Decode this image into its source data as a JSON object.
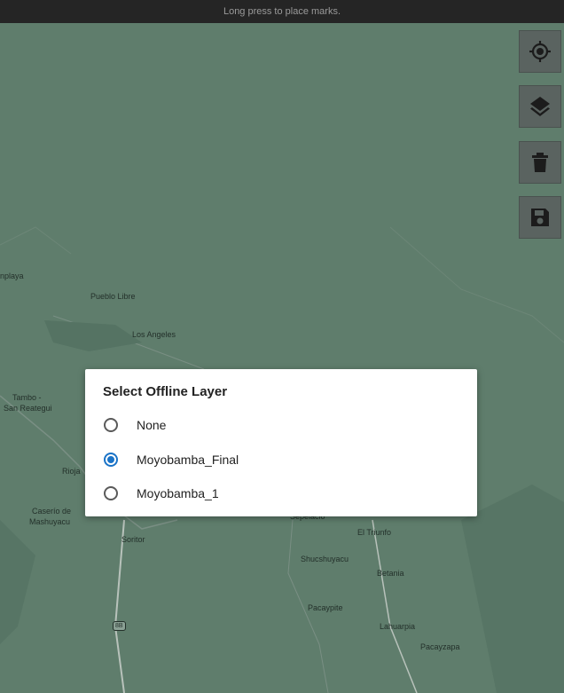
{
  "hint_text": "Long press to place marks.",
  "map": {
    "places": [
      {
        "name": "nplaya"
      },
      {
        "name": "Pueblo Libre"
      },
      {
        "name": "Los Angeles"
      },
      {
        "name": "Tambo -"
      },
      {
        "name": "San Reategui"
      },
      {
        "name": "Rioja"
      },
      {
        "name": "Caserío de"
      },
      {
        "name": "Mashuyacu"
      },
      {
        "name": "Soritor"
      },
      {
        "name": "Sepelacio"
      },
      {
        "name": "El Triunfo"
      },
      {
        "name": "Shucshuyacu"
      },
      {
        "name": "Betania"
      },
      {
        "name": "Pacaypite"
      },
      {
        "name": "Lahuarpia"
      },
      {
        "name": "Pacayzapa"
      }
    ],
    "road_badge": "8B"
  },
  "toolbar": {
    "locate_icon": "crosshair-icon",
    "layers_icon": "layers-icon",
    "delete_icon": "trash-icon",
    "save_icon": "floppy-disk-icon"
  },
  "dialog": {
    "title": "Select Offline Layer",
    "options": [
      {
        "label": "None",
        "selected": false
      },
      {
        "label": "Moyobamba_Final",
        "selected": true
      },
      {
        "label": "Moyobamba_1",
        "selected": false
      }
    ]
  },
  "colors": {
    "accent": "#1a73c7",
    "map_dim": "#5f7d6c",
    "topbar": "#252525"
  }
}
